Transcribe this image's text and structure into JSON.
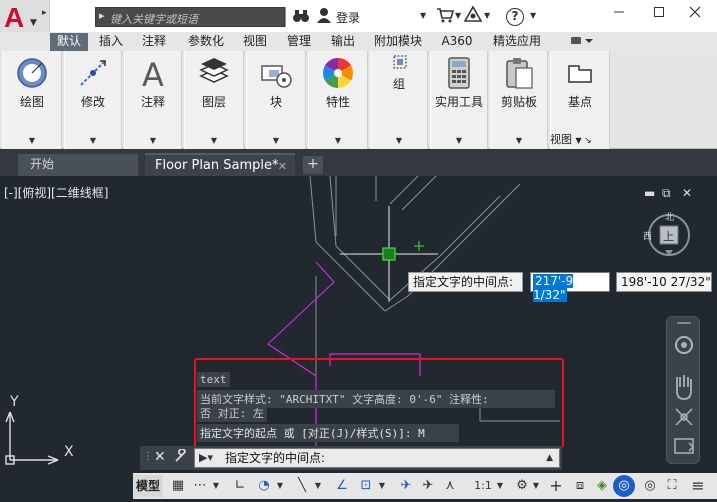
{
  "title_bar": {
    "search_placeholder": "键入关键字或短语",
    "login_label": "登录",
    "help_label": "?"
  },
  "ribbon_tabs": [
    "默认",
    "插入",
    "注释",
    "参数化",
    "视图",
    "管理",
    "输出",
    "附加模块",
    "A360",
    "精选应用"
  ],
  "ribbon_buttons": {
    "draw": "绘图",
    "modify": "修改",
    "annotation": "注释",
    "layers": "图层",
    "block": "块",
    "properties": "特性",
    "group": "组",
    "utilities": "实用工具",
    "clipboard": "剪贴板",
    "base": "基点",
    "view_panel": "视图"
  },
  "file_tabs": {
    "start": "开始",
    "drawing": "Floor Plan Sample*",
    "new_tab": "+"
  },
  "canvas": {
    "viewport_label": "[-][俯视][二维线框]",
    "viewcube": {
      "north": "北",
      "west": "西",
      "top": "上"
    },
    "prompt_tooltip": "指定文字的中间点:",
    "coord_x": "217'-9 1/32\"",
    "coord_y": "198'-10 27/32\"",
    "ucs_y": "Y",
    "ucs_x": "X"
  },
  "command_history": [
    "text",
    "当前文字样式:  \"ARCHITXT\"  文字高度:  0'-6\"  注释性:",
    "否  对正:  左",
    "指定文字的起点 或 [对正(J)/样式(S)]: M"
  ],
  "command_line": {
    "current": "指定文字的中间点:"
  },
  "status_bar": {
    "model": "模型",
    "scale": "1:1"
  },
  "colors": {
    "canvas": "#212830",
    "highlight": "#e8141c",
    "magenta": "#d42bd4",
    "selection": "#0078d7",
    "active_tab": "#5f6b79"
  }
}
